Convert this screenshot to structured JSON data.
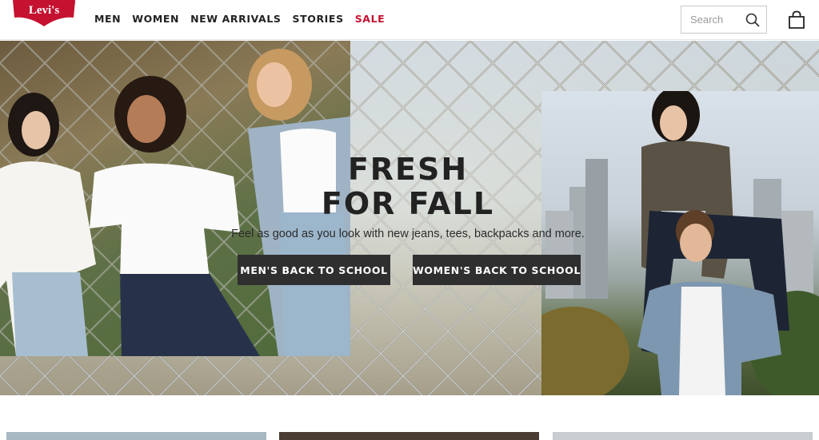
{
  "header": {
    "logo_text": "Levi's",
    "nav": [
      {
        "label": "MEN",
        "key": "men"
      },
      {
        "label": "WOMEN",
        "key": "women"
      },
      {
        "label": "NEW ARRIVALS",
        "key": "new-arrivals"
      },
      {
        "label": "STORIES",
        "key": "stories"
      },
      {
        "label": "SALE",
        "key": "sale"
      }
    ],
    "search": {
      "placeholder": "Search",
      "value": ""
    },
    "icons": {
      "search": "search-icon",
      "bag": "shopping-bag-icon"
    }
  },
  "hero": {
    "title": "FRESH\nFOR FALL",
    "subtitle": "Feel as good as you look with new jeans, tees, backpacks and more.",
    "buttons": {
      "men": "MEN'S BACK TO SCHOOL",
      "women": "WOMEN'S BACK TO SCHOOL"
    }
  },
  "colors": {
    "brand_red": "#c41230",
    "sale": "#c41230",
    "button_bg": "#2f2f2f"
  }
}
